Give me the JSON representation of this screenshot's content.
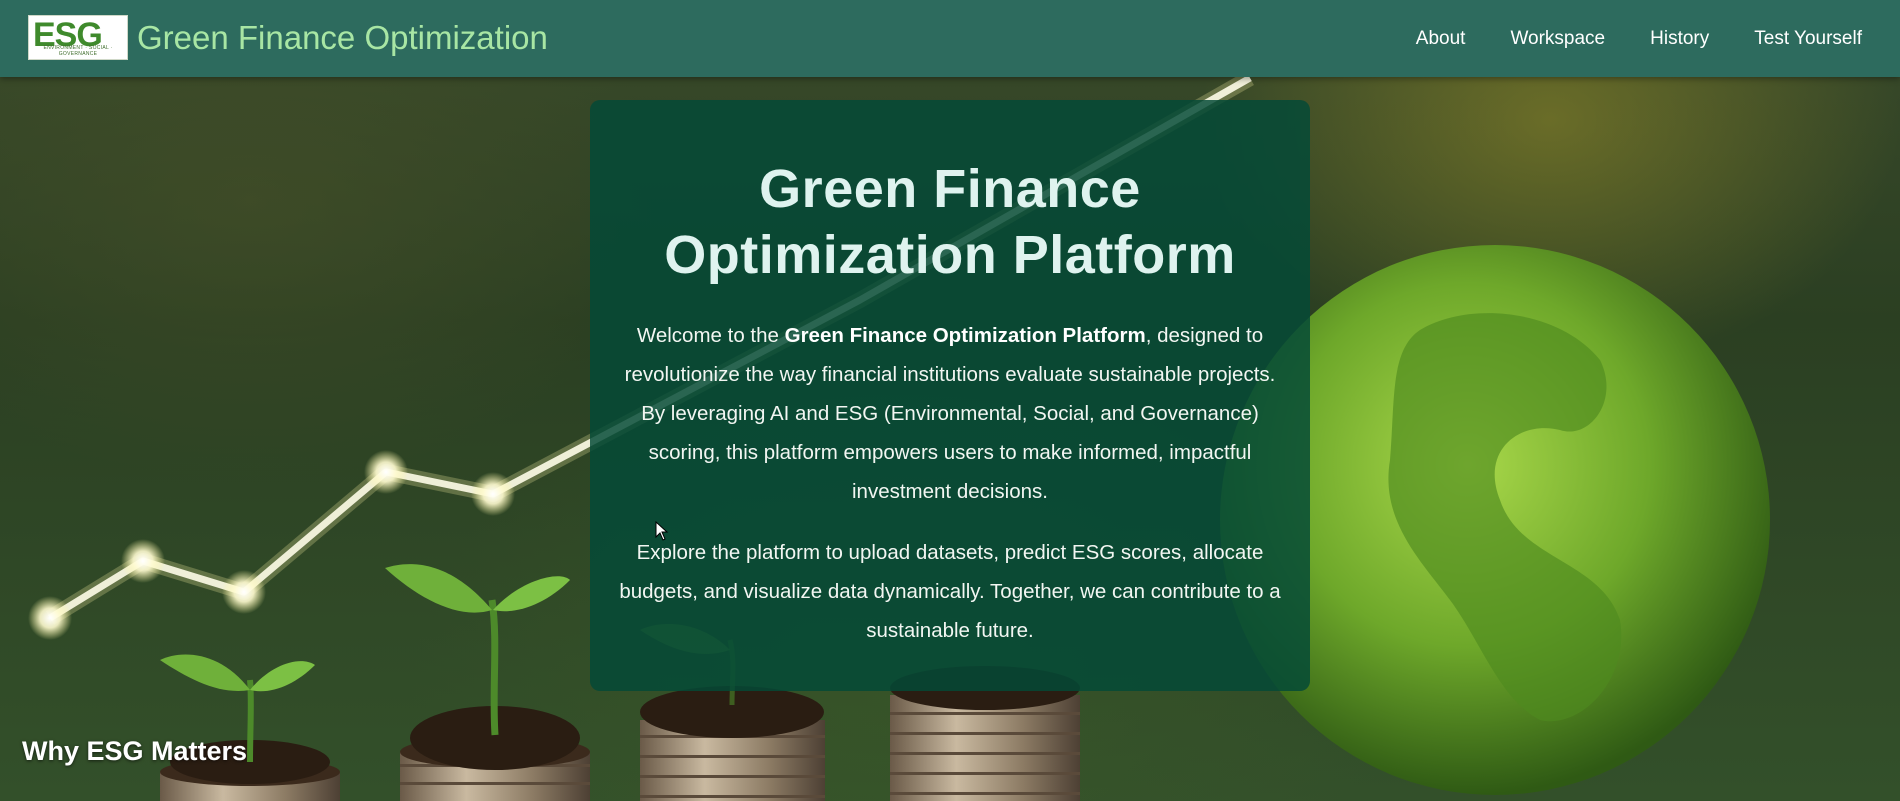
{
  "header": {
    "logo": {
      "text": "ESG",
      "subtext": "ENVIRONMENT · SOCIAL · GOVERNANCE"
    },
    "brand_title": "Green Finance Optimization",
    "nav": [
      {
        "label": "About"
      },
      {
        "label": "Workspace"
      },
      {
        "label": "History"
      },
      {
        "label": "Test Yourself"
      }
    ]
  },
  "intro": {
    "title": "Green Finance Optimization Platform",
    "para1_prefix": "Welcome to the ",
    "para1_bold": "Green Finance Optimization Platform",
    "para1_suffix": ", designed to revolutionize the way financial institutions evaluate sustainable projects. By leveraging AI and ESG (Environmental, Social, and Governance) scoring, this platform empowers users to make informed, impactful investment decisions.",
    "para2": "Explore the platform to upload datasets, predict ESG scores, allocate budgets, and visualize data dynamically. Together, we can contribute to a sustainable future."
  },
  "section": {
    "heading": "Why ESG Matters"
  },
  "colors": {
    "navbar_bg": "#2d6b5e",
    "brand_title": "#a8e6a4",
    "card_bg": "#044a37",
    "card_title": "#dff3ef"
  },
  "icons": {
    "cursor": "mouse-pointer-icon"
  }
}
